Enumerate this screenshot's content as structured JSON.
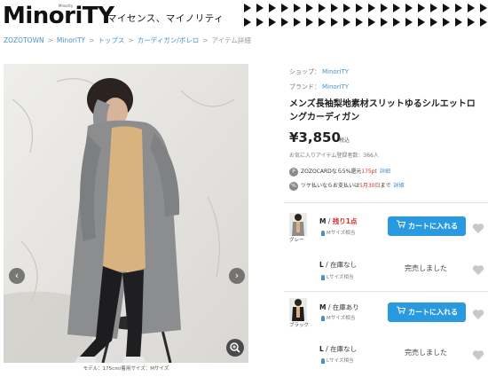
{
  "header": {
    "logo_text": "MinoriTY",
    "logo_sub": "Minority",
    "tagline": "マイセンス、マイノリティ"
  },
  "breadcrumb": {
    "items": [
      "ZOZOTOWN",
      "MinoriTY",
      "トップス",
      "カーディガン/ボレロ"
    ],
    "current": "アイテム詳細"
  },
  "photo": {
    "caption": "モデル：175cm/着用サイズ：Mサイズ"
  },
  "product": {
    "shop_label": "ショップ：",
    "shop_value": "MinoriTY",
    "brand_label": "ブランド：",
    "brand_value": "MinoriTY",
    "title": "メンズ長袖梨地素材スリットゆるシルエットロングカーディガン",
    "price": "¥3,850",
    "tax": "税込",
    "favorites": "お気に入りアイテム登録者数：366人",
    "promo_zozocard": {
      "badge": "P",
      "text_before": "ZOZOCARDなら5%還元",
      "highlight": "175pt",
      "link": "詳細"
    },
    "promo_tsuke": {
      "badge": "%",
      "text_before": "ツケ払いならお支払いは",
      "highlight": "5月30日",
      "text_after": "まで",
      "link": "詳細"
    }
  },
  "variants": [
    {
      "color": "グレー",
      "rows": [
        {
          "size": "M",
          "stock": "残り1点",
          "stock_red": true,
          "guide": "Mサイズ相当",
          "action": "cart",
          "action_label": "カートに入れる"
        },
        {
          "size": "L",
          "stock": "在庫なし",
          "stock_red": false,
          "guide": "Lサイズ相当",
          "action": "soldout",
          "action_label": "完売しました"
        }
      ]
    },
    {
      "color": "ブラック",
      "rows": [
        {
          "size": "M",
          "stock": "在庫あり",
          "stock_red": false,
          "guide": "Mサイズ相当",
          "action": "cart",
          "action_label": "カートに入れる"
        },
        {
          "size": "L",
          "stock": "在庫なし",
          "stock_red": false,
          "guide": "Lサイズ相当",
          "action": "soldout",
          "action_label": "完売しました"
        }
      ]
    }
  ],
  "size_separator": " / ",
  "colors": {
    "link": "#4a90c8",
    "cart_button": "#2a9ae0",
    "accent_red": "#d9302c"
  },
  "icons": {
    "prev": "chevron-left-icon",
    "next": "chevron-right-icon",
    "zoom": "zoom-icon",
    "cart": "cart-icon",
    "favorite": "heart-icon"
  }
}
